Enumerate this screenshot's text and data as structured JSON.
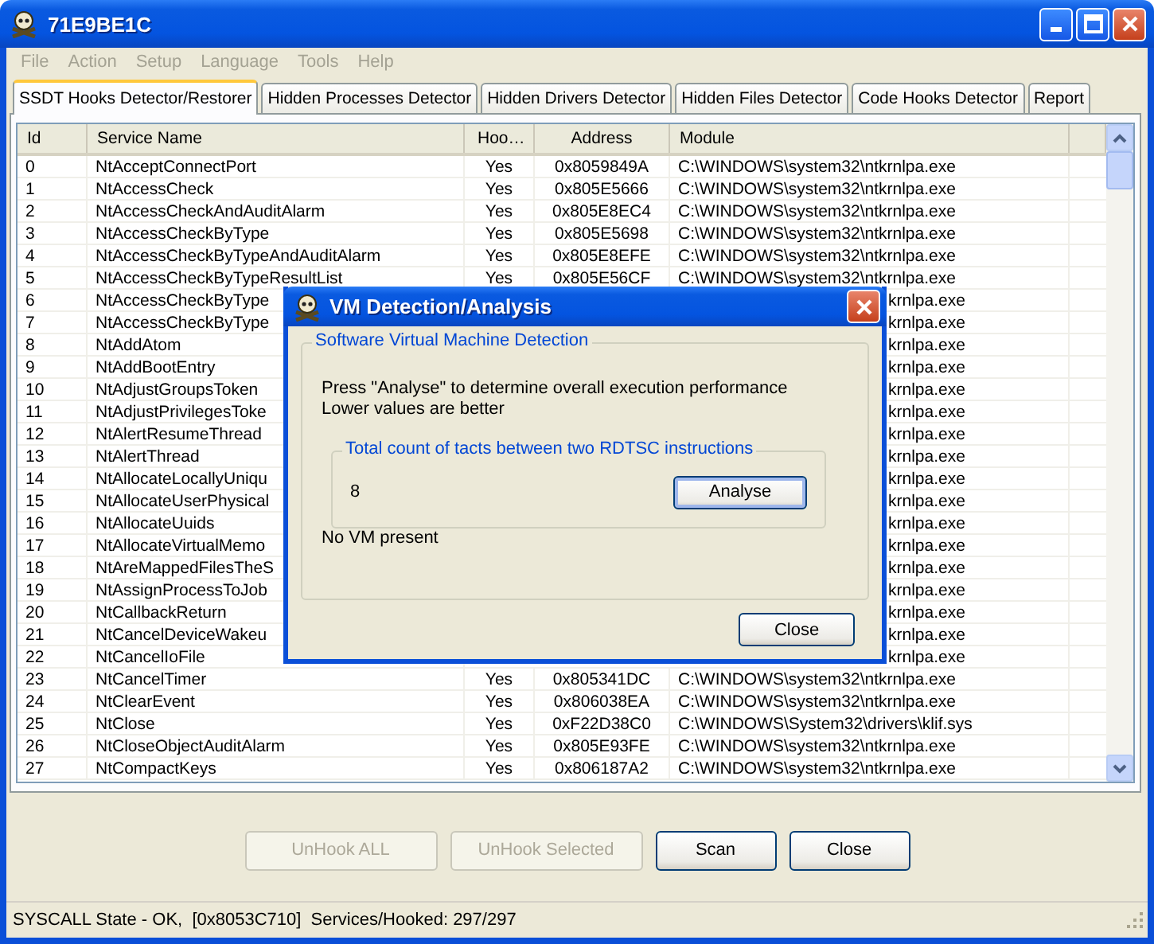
{
  "window": {
    "title": "71E9BE1C"
  },
  "menu": [
    {
      "label": "File",
      "disabled": true
    },
    {
      "label": "Action",
      "disabled": true
    },
    {
      "label": "Setup",
      "disabled": true
    },
    {
      "label": "Language",
      "disabled": true
    },
    {
      "label": "Tools",
      "disabled": true
    },
    {
      "label": "Help",
      "disabled": true
    }
  ],
  "tabs": [
    {
      "label": "SSDT Hooks Detector/Restorer",
      "selected": true
    },
    {
      "label": "Hidden Processes Detector",
      "selected": false
    },
    {
      "label": "Hidden Drivers Detector",
      "selected": false
    },
    {
      "label": "Hidden Files Detector",
      "selected": false
    },
    {
      "label": "Code Hooks Detector",
      "selected": false
    },
    {
      "label": "Report",
      "selected": false
    }
  ],
  "table": {
    "columns": [
      "Id",
      "Service Name",
      "Hoo…",
      "Address",
      "Module"
    ],
    "rows": [
      {
        "kind": "full",
        "cells": [
          "0",
          "NtAcceptConnectPort",
          "Yes",
          "0x8059849A",
          "C:\\WINDOWS\\system32\\ntkrnlpa.exe"
        ]
      },
      {
        "kind": "full",
        "cells": [
          "1",
          "NtAccessCheck",
          "Yes",
          "0x805E5666",
          "C:\\WINDOWS\\system32\\ntkrnlpa.exe"
        ]
      },
      {
        "kind": "full",
        "cells": [
          "2",
          "NtAccessCheckAndAuditAlarm",
          "Yes",
          "0x805E8EC4",
          "C:\\WINDOWS\\system32\\ntkrnlpa.exe"
        ]
      },
      {
        "kind": "full",
        "cells": [
          "3",
          "NtAccessCheckByType",
          "Yes",
          "0x805E5698",
          "C:\\WINDOWS\\system32\\ntkrnlpa.exe"
        ]
      },
      {
        "kind": "full",
        "cells": [
          "4",
          "NtAccessCheckByTypeAndAuditAlarm",
          "Yes",
          "0x805E8EFE",
          "C:\\WINDOWS\\system32\\ntkrnlpa.exe"
        ]
      },
      {
        "kind": "full",
        "cells": [
          "5",
          "NtAccessCheckByTypeResultList",
          "Yes",
          "0x805E56CF",
          "C:\\WINDOWS\\system32\\ntkrnlpa.exe"
        ]
      },
      {
        "kind": "covered",
        "cells": [
          "6",
          "NtAccessCheckByType",
          "krnlpa.exe"
        ]
      },
      {
        "kind": "covered",
        "cells": [
          "7",
          "NtAccessCheckByType",
          "krnlpa.exe"
        ]
      },
      {
        "kind": "covered",
        "cells": [
          "8",
          "NtAddAtom",
          "krnlpa.exe"
        ]
      },
      {
        "kind": "covered",
        "cells": [
          "9",
          "NtAddBootEntry",
          "krnlpa.exe"
        ]
      },
      {
        "kind": "covered",
        "cells": [
          "10",
          "NtAdjustGroupsToken",
          "krnlpa.exe"
        ]
      },
      {
        "kind": "covered",
        "cells": [
          "11",
          "NtAdjustPrivilegesToke",
          "krnlpa.exe"
        ]
      },
      {
        "kind": "covered",
        "cells": [
          "12",
          "NtAlertResumeThread",
          "krnlpa.exe"
        ]
      },
      {
        "kind": "covered",
        "cells": [
          "13",
          "NtAlertThread",
          "krnlpa.exe"
        ]
      },
      {
        "kind": "covered",
        "cells": [
          "14",
          "NtAllocateLocallyUniqu",
          "krnlpa.exe"
        ]
      },
      {
        "kind": "covered",
        "cells": [
          "15",
          "NtAllocateUserPhysical",
          "krnlpa.exe"
        ]
      },
      {
        "kind": "covered",
        "cells": [
          "16",
          "NtAllocateUuids",
          "krnlpa.exe"
        ]
      },
      {
        "kind": "covered",
        "cells": [
          "17",
          "NtAllocateVirtualMemo",
          "krnlpa.exe"
        ]
      },
      {
        "kind": "covered",
        "cells": [
          "18",
          "NtAreMappedFilesTheS",
          "krnlpa.exe"
        ]
      },
      {
        "kind": "covered",
        "cells": [
          "19",
          "NtAssignProcessToJob",
          "krnlpa.exe"
        ]
      },
      {
        "kind": "covered",
        "cells": [
          "20",
          "NtCallbackReturn",
          "krnlpa.exe"
        ]
      },
      {
        "kind": "covered",
        "cells": [
          "21",
          "NtCancelDeviceWakeu",
          "krnlpa.exe"
        ]
      },
      {
        "kind": "covered",
        "cells": [
          "22",
          "NtCancelIoFile",
          "krnlpa.exe"
        ]
      },
      {
        "kind": "full",
        "cells": [
          "23",
          "NtCancelTimer",
          "Yes",
          "0x805341DC",
          "C:\\WINDOWS\\system32\\ntkrnlpa.exe"
        ]
      },
      {
        "kind": "full",
        "cells": [
          "24",
          "NtClearEvent",
          "Yes",
          "0x806038EA",
          "C:\\WINDOWS\\system32\\ntkrnlpa.exe"
        ]
      },
      {
        "kind": "full",
        "cells": [
          "25",
          "NtClose",
          "Yes",
          "0xF22D38C0",
          "C:\\WINDOWS\\System32\\drivers\\klif.sys"
        ]
      },
      {
        "kind": "full",
        "cells": [
          "26",
          "NtCloseObjectAuditAlarm",
          "Yes",
          "0x805E93FE",
          "C:\\WINDOWS\\system32\\ntkrnlpa.exe"
        ]
      },
      {
        "kind": "full",
        "cells": [
          "27",
          "NtCompactKeys",
          "Yes",
          "0x806187A2",
          "C:\\WINDOWS\\system32\\ntkrnlpa.exe"
        ]
      }
    ]
  },
  "buttons": [
    {
      "label": "UnHook ALL",
      "disabled": true
    },
    {
      "label": "UnHook Selected",
      "disabled": true
    },
    {
      "label": "Scan",
      "disabled": false
    },
    {
      "label": "Close",
      "disabled": false
    }
  ],
  "status_bar": "SYSCALL State - OK,  [0x8053C710]  Services/Hooked: 297/297",
  "dialog": {
    "title": "VM Detection/Analysis",
    "group_title": "Software Virtual Machine Detection",
    "description_lines": [
      "Press \"Analyse\" to determine overall execution performance",
      "Lower values are better"
    ],
    "inner_group_title": "Total count of tacts between two RDTSC instructions",
    "count": "8",
    "analyse_button": "Analyse",
    "result": "No VM present",
    "close_button": "Close"
  }
}
